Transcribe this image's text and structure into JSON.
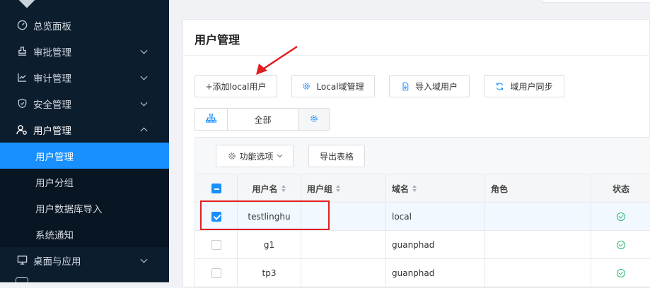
{
  "sidebar": {
    "items": [
      {
        "label": "总览面板",
        "icon": "dashboard-icon"
      },
      {
        "label": "审批管理",
        "icon": "stamp-icon"
      },
      {
        "label": "审计管理",
        "icon": "trend-chart-icon"
      },
      {
        "label": "安全管理",
        "icon": "shield-icon"
      },
      {
        "label": "用户管理",
        "icon": "user-settings-icon"
      },
      {
        "label": "桌面与应用",
        "icon": "monitor-icon"
      }
    ],
    "subitems": [
      {
        "label": "用户管理"
      },
      {
        "label": "用户分组"
      },
      {
        "label": "用户数据库导入"
      },
      {
        "label": "系统通知"
      }
    ]
  },
  "page": {
    "title": "用户管理"
  },
  "toolbar": {
    "add_local_user": "+添加local用户",
    "local_domain_manage": "Local域管理",
    "import_domain_user": "导入域用户",
    "domain_user_sync": "域用户同步"
  },
  "filter": {
    "all": "全部"
  },
  "table": {
    "func_options": "功能选项",
    "export": "导出表格",
    "headers": {
      "username": "用户名",
      "group": "用户组",
      "domain": "域名",
      "role": "角色",
      "status": "状态"
    },
    "rows": [
      {
        "username": "testlinghu",
        "group": "",
        "domain": "local",
        "role": "",
        "checked": true
      },
      {
        "username": "g1",
        "group": "",
        "domain": "guanphad",
        "role": "",
        "checked": false
      },
      {
        "username": "tp3",
        "group": "",
        "domain": "guanphad",
        "role": "",
        "checked": false
      }
    ]
  },
  "colors": {
    "sidebar_bg": "#0c1d2e",
    "accent": "#1890ff",
    "status_ok": "#2bb673",
    "annotation": "#e02020"
  }
}
